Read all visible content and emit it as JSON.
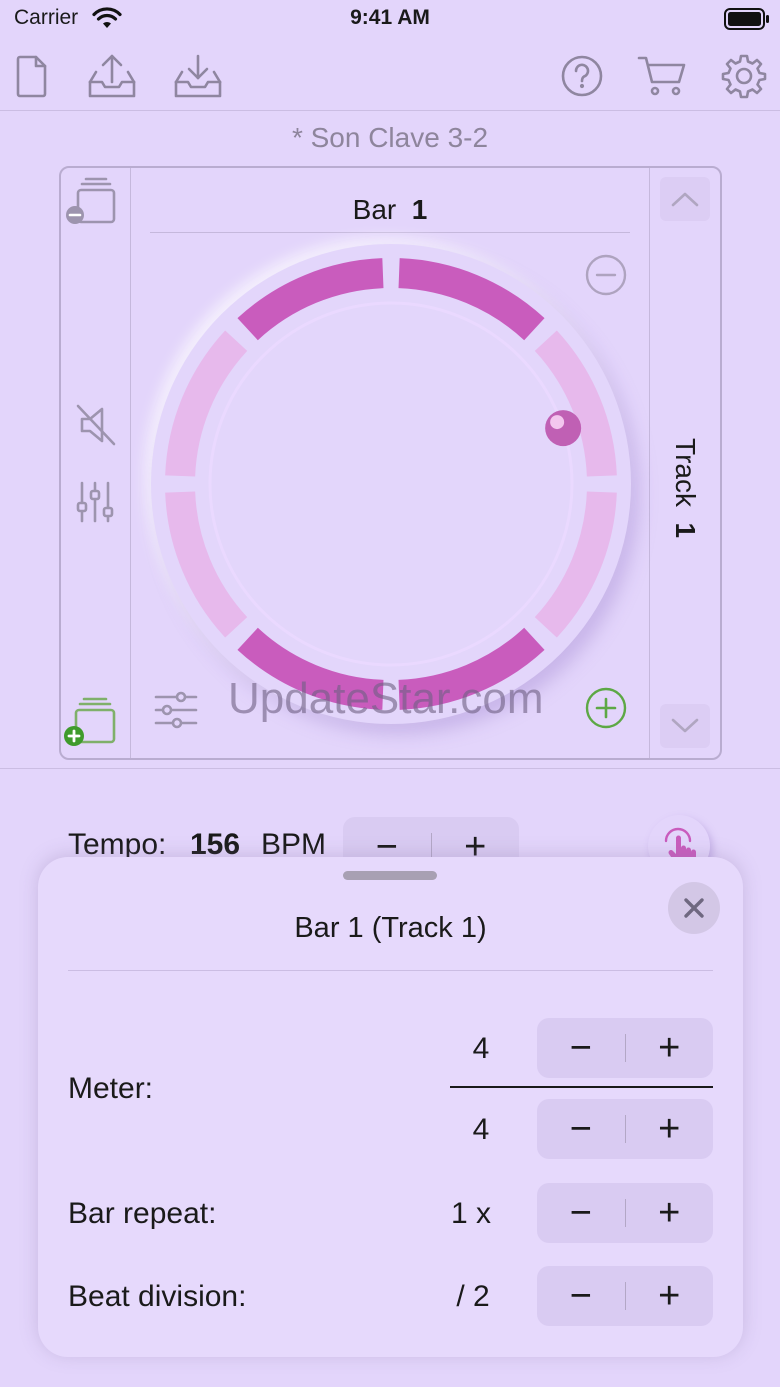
{
  "status_bar": {
    "carrier": "Carrier",
    "time": "9:41 AM"
  },
  "toolbar": {
    "left": [
      "new-file-icon",
      "export-icon",
      "import-icon"
    ],
    "right": [
      "help-icon",
      "cart-icon",
      "settings-icon"
    ]
  },
  "song": {
    "title": "* Son Clave 3-2"
  },
  "editor": {
    "bar_label": "Bar",
    "bar_number": "1",
    "track_label": "Track",
    "track_number": "1",
    "ring": {
      "segments": 8,
      "active_segments": [
        0,
        3,
        4,
        7
      ],
      "active_color": "#c95cbd",
      "inactive_color": "#e7b9ec",
      "playhead_segment": 1
    }
  },
  "watermark": "UpdateStar.com",
  "tempo": {
    "label": "Tempo:",
    "value": "156",
    "unit": "BPM",
    "minus": "−",
    "plus": "+"
  },
  "sheet": {
    "title": "Bar 1 (Track 1)",
    "close": "✕",
    "meter": {
      "label": "Meter:",
      "numerator": "4",
      "denominator": "4"
    },
    "bar_repeat": {
      "label": "Bar repeat:",
      "value": "1 x"
    },
    "beat_division": {
      "label": "Beat division:",
      "value": "/ 2"
    },
    "minus": "−",
    "plus": "+"
  }
}
